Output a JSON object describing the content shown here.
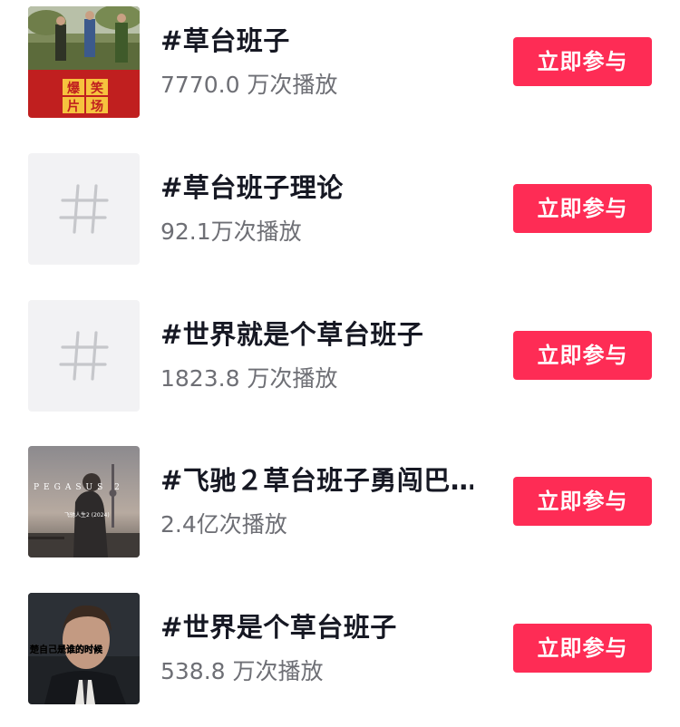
{
  "topics": [
    {
      "title": "#草台班子",
      "plays": "7770.0 万次播放",
      "button": "立即参与",
      "thumb_type": "photo-comedy",
      "thumb_caption": "爆笑片场"
    },
    {
      "title": "#草台班子理论",
      "plays": "92.1万次播放",
      "button": "立即参与",
      "thumb_type": "hash-placeholder"
    },
    {
      "title": "#世界就是个草台班子",
      "plays": "1823.8 万次播放",
      "button": "立即参与",
      "thumb_type": "hash-placeholder"
    },
    {
      "title": "#飞驰２草台班子勇闯巴…",
      "plays": "2.4亿次播放",
      "button": "立即参与",
      "thumb_type": "photo-film",
      "thumb_caption": "PEGASUS 2",
      "thumb_subcaption": "飞驰人生2 (2024)"
    },
    {
      "title": "#世界是个草台班子",
      "plays": "538.8 万次播放",
      "button": "立即参与",
      "thumb_type": "photo-portrait",
      "thumb_caption": "楚自己是谁的时候"
    }
  ],
  "colors": {
    "button_bg": "#fe2c55",
    "button_text": "#ffffff",
    "title": "#161823",
    "plays": "#6e6f75",
    "placeholder_bg": "#f2f2f4"
  }
}
